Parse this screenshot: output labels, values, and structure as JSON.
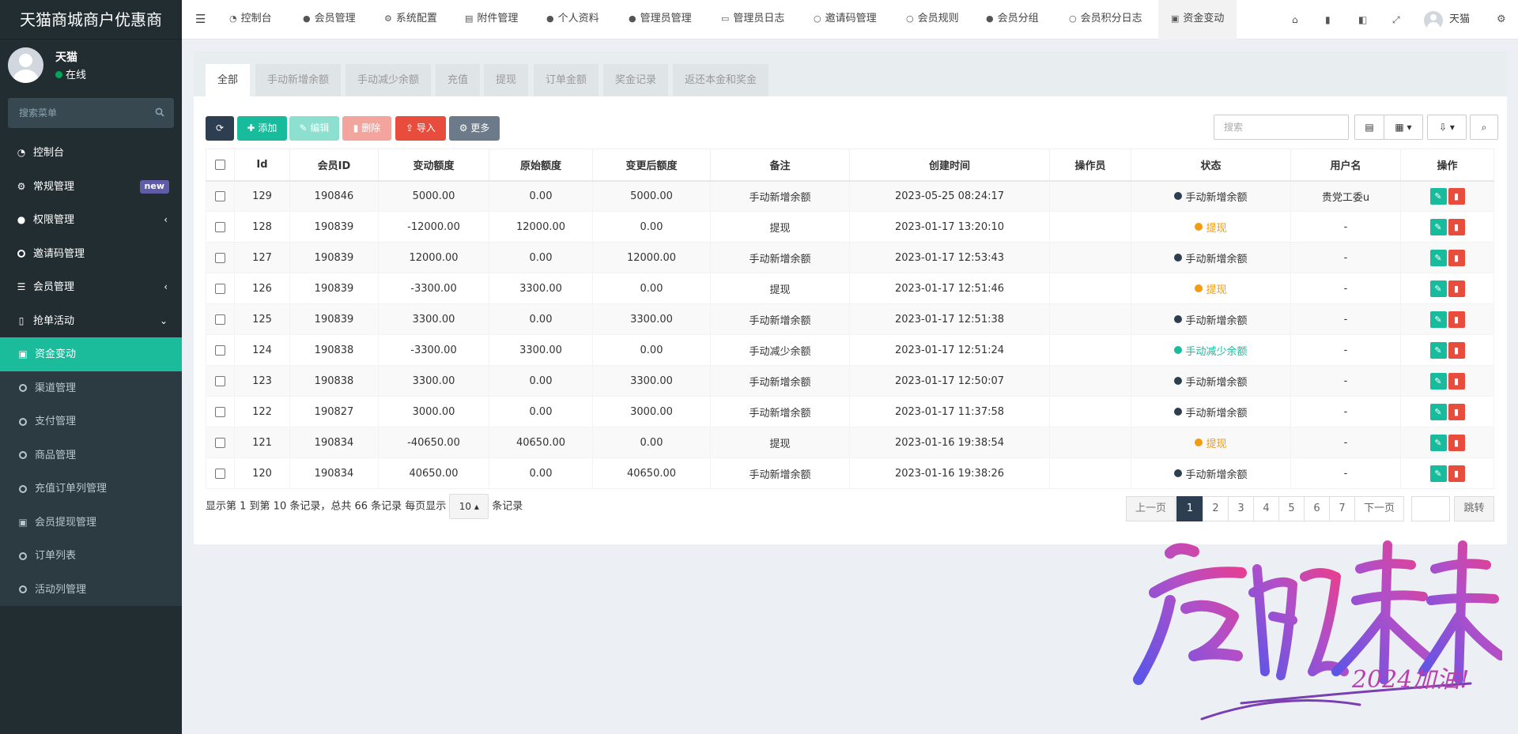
{
  "sidebar": {
    "logo": "天猫商城商户优惠商",
    "user_name": "天猫",
    "user_status": "在线",
    "search_placeholder": "搜索菜单",
    "items": [
      {
        "label": "控制台",
        "icon": "dashboard-icon"
      },
      {
        "label": "常规管理",
        "icon": "cogs-icon",
        "badge": "new"
      },
      {
        "label": "权限管理",
        "icon": "group-icon"
      },
      {
        "label": "邀请码管理",
        "icon": "circle-icon"
      },
      {
        "label": "会员管理",
        "icon": "list-icon"
      },
      {
        "label": "抢单活动",
        "icon": "bookmark-icon"
      },
      {
        "label": "资金变动",
        "icon": "money-icon"
      },
      {
        "label": "渠道管理",
        "icon": "circle-icon"
      },
      {
        "label": "支付管理",
        "icon": "circle-icon"
      },
      {
        "label": "商品管理",
        "icon": "circle-icon"
      },
      {
        "label": "充值订单列管理",
        "icon": "circle-icon"
      },
      {
        "label": "会员提现管理",
        "icon": "money-icon"
      },
      {
        "label": "订单列表",
        "icon": "circle-icon"
      },
      {
        "label": "活动列管理",
        "icon": "circle-icon"
      }
    ]
  },
  "topnav": {
    "tabs": [
      {
        "label": "控制台",
        "icon": "dashboard-icon"
      },
      {
        "label": "会员管理",
        "icon": "user-icon"
      },
      {
        "label": "系统配置",
        "icon": "cog-icon"
      },
      {
        "label": "附件管理",
        "icon": "file-image-icon"
      },
      {
        "label": "个人资料",
        "icon": "user-icon"
      },
      {
        "label": "管理员管理",
        "icon": "user-icon"
      },
      {
        "label": "管理员日志",
        "icon": "list-alt-icon"
      },
      {
        "label": "邀请码管理",
        "icon": "circle-icon"
      },
      {
        "label": "会员规则",
        "icon": "circle-icon"
      },
      {
        "label": "会员分组",
        "icon": "users-icon"
      },
      {
        "label": "会员积分日志",
        "icon": "circle-icon"
      },
      {
        "label": "资金变动",
        "icon": "money-icon"
      }
    ],
    "user_name": "天猫"
  },
  "filter_tabs": [
    "全部",
    "手动新增余额",
    "手动减少余额",
    "充值",
    "提现",
    "订单金额",
    "奖金记录",
    "返还本金和奖金"
  ],
  "toolbar": {
    "refresh": "",
    "add": "添加",
    "edit": "编辑",
    "delete": "删除",
    "import": "导入",
    "more": "更多",
    "search_placeholder": "搜索"
  },
  "table": {
    "headers": [
      "Id",
      "会员ID",
      "变动额度",
      "原始额度",
      "变更后额度",
      "备注",
      "创建时间",
      "操作员",
      "状态",
      "用户名",
      "操作"
    ],
    "rows": [
      {
        "id": "129",
        "member_id": "190846",
        "amount": "5000.00",
        "before": "0.00",
        "after": "5000.00",
        "remark": "手动新增余额",
        "time": "2023-05-25 08:24:17",
        "operator": "",
        "status": "手动新增余额",
        "status_color": "#2c3e50",
        "username": "贵党工委u"
      },
      {
        "id": "128",
        "member_id": "190839",
        "amount": "-12000.00",
        "before": "12000.00",
        "after": "0.00",
        "remark": "提现",
        "time": "2023-01-17 13:20:10",
        "operator": "",
        "status": "提现",
        "status_color": "#f39c12",
        "username": "-"
      },
      {
        "id": "127",
        "member_id": "190839",
        "amount": "12000.00",
        "before": "0.00",
        "after": "12000.00",
        "remark": "手动新增余额",
        "time": "2023-01-17 12:53:43",
        "operator": "",
        "status": "手动新增余额",
        "status_color": "#2c3e50",
        "username": "-"
      },
      {
        "id": "126",
        "member_id": "190839",
        "amount": "-3300.00",
        "before": "3300.00",
        "after": "0.00",
        "remark": "提现",
        "time": "2023-01-17 12:51:46",
        "operator": "",
        "status": "提现",
        "status_color": "#f39c12",
        "username": "-"
      },
      {
        "id": "125",
        "member_id": "190839",
        "amount": "3300.00",
        "before": "0.00",
        "after": "3300.00",
        "remark": "手动新增余额",
        "time": "2023-01-17 12:51:38",
        "operator": "",
        "status": "手动新增余额",
        "status_color": "#2c3e50",
        "username": "-"
      },
      {
        "id": "124",
        "member_id": "190838",
        "amount": "-3300.00",
        "before": "3300.00",
        "after": "0.00",
        "remark": "手动减少余额",
        "time": "2023-01-17 12:51:24",
        "operator": "",
        "status": "手动减少余额",
        "status_color": "#18bc9c",
        "username": "-"
      },
      {
        "id": "123",
        "member_id": "190838",
        "amount": "3300.00",
        "before": "0.00",
        "after": "3300.00",
        "remark": "手动新增余额",
        "time": "2023-01-17 12:50:07",
        "operator": "",
        "status": "手动新增余额",
        "status_color": "#2c3e50",
        "username": "-"
      },
      {
        "id": "122",
        "member_id": "190827",
        "amount": "3000.00",
        "before": "0.00",
        "after": "3000.00",
        "remark": "手动新增余额",
        "time": "2023-01-17 11:37:58",
        "operator": "",
        "status": "手动新增余额",
        "status_color": "#2c3e50",
        "username": "-"
      },
      {
        "id": "121",
        "member_id": "190834",
        "amount": "-40650.00",
        "before": "40650.00",
        "after": "0.00",
        "remark": "提现",
        "time": "2023-01-16 19:38:54",
        "operator": "",
        "status": "提现",
        "status_color": "#f39c12",
        "username": "-"
      },
      {
        "id": "120",
        "member_id": "190834",
        "amount": "40650.00",
        "before": "0.00",
        "after": "40650.00",
        "remark": "手动新增余额",
        "time": "2023-01-16 19:38:26",
        "operator": "",
        "status": "手动新增余额",
        "status_color": "#2c3e50",
        "username": "-"
      }
    ]
  },
  "pagination": {
    "info_before": "显示第 1 到第 10 条记录，总共 66 条记录 每页显示",
    "page_size": "10",
    "info_after": "条记录",
    "prev": "上一页",
    "pages": [
      "1",
      "2",
      "3",
      "4",
      "5",
      "6",
      "7"
    ],
    "current": "1",
    "next": "下一页",
    "jump": "跳转"
  },
  "watermark": {
    "text": "启航未来",
    "sub": "2024加油!"
  },
  "colors": {
    "sidebar_bg": "#222d32",
    "accent": "#1abc9c",
    "btn_dark": "#2c3e50",
    "btn_green": "#18bc9c",
    "btn_red": "#e74c3c",
    "btn_gray": "#95a5a6"
  }
}
